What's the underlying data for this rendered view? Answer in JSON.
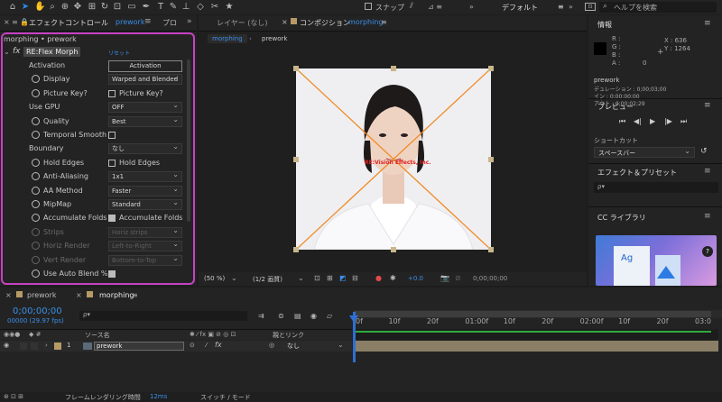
{
  "toolbar": {
    "snap_label": "スナップ",
    "workspace_label": "デフォルト",
    "search_placeholder": "ヘルプを検索"
  },
  "effects_panel": {
    "tab_label": "エフェクトコントロール",
    "tab_layer": "prework",
    "tab_other": "プロ",
    "breadcrumb": "morphing • prework",
    "effect_name": "RE:Flex Morph",
    "reset_label": "リセット",
    "rows": [
      {
        "name": "Activation",
        "type": "button",
        "value": "Activation",
        "indent": 0,
        "stopwatch": false
      },
      {
        "name": "Display",
        "type": "dropdown",
        "value": "Warped and Blended",
        "indent": 1,
        "stopwatch": true
      },
      {
        "name": "Picture Key?",
        "type": "checkbox",
        "value": "Picture Key?",
        "checked": false,
        "indent": 1,
        "stopwatch": true
      },
      {
        "name": "Use GPU",
        "type": "dropdown",
        "value": "OFF",
        "indent": 0,
        "stopwatch": false
      },
      {
        "name": "Quality",
        "type": "dropdown",
        "value": "Best",
        "indent": 1,
        "stopwatch": true
      },
      {
        "name": "Temporal Smooth",
        "type": "checkbox",
        "value": "",
        "checked": false,
        "indent": 1,
        "stopwatch": true
      },
      {
        "name": "Boundary",
        "type": "dropdown",
        "value": "なし",
        "indent": 0,
        "stopwatch": false
      },
      {
        "name": "Hold Edges",
        "type": "checkbox",
        "value": "Hold Edges",
        "checked": false,
        "indent": 1,
        "stopwatch": true
      },
      {
        "name": "Anti-Aliasing",
        "type": "dropdown",
        "value": "1x1",
        "indent": 1,
        "stopwatch": true
      },
      {
        "name": "AA Method",
        "type": "dropdown",
        "value": "Faster",
        "indent": 1,
        "stopwatch": true
      },
      {
        "name": "MipMap",
        "type": "dropdown",
        "value": "Standard",
        "indent": 1,
        "stopwatch": true
      },
      {
        "name": "Accumulate Folds",
        "type": "checkbox",
        "value": "Accumulate Folds",
        "checked": true,
        "indent": 1,
        "stopwatch": true
      },
      {
        "name": "Strips",
        "type": "dropdown",
        "value": "Horiz strips",
        "indent": 1,
        "stopwatch": true,
        "dim": true
      },
      {
        "name": "Horiz Render",
        "type": "dropdown",
        "value": "Left-to-Right",
        "indent": 1,
        "stopwatch": true,
        "dim": true
      },
      {
        "name": "Vert Render",
        "type": "dropdown",
        "value": "Bottom-to-Top",
        "indent": 1,
        "stopwatch": true,
        "dim": true
      },
      {
        "name": "Use Auto Blend %",
        "type": "checkbox",
        "value": "",
        "checked": true,
        "indent": 1,
        "stopwatch": true
      }
    ]
  },
  "viewer": {
    "layer_tab": "レイヤー (なし)",
    "comp_tab": "コンポジション",
    "comp_name": "morphing",
    "flow_items": [
      "morphing",
      "prework"
    ],
    "watermark": "RE:Vision Effects, Inc.",
    "zoom": "(50 %)",
    "resolution": "(1/2 画質)",
    "exposure": "+0.0",
    "timecode": "0;00;00;00"
  },
  "info_panel": {
    "title": "情報",
    "r": "R :",
    "g": "G :",
    "b": "B :",
    "a": "A :",
    "a_val": "0",
    "x": "X : 636",
    "y": "Y : 1264",
    "layer_name": "prework",
    "duration": "デュレーション : 0;00;03;00",
    "in": "イン : 0;00;00;00",
    "out": "アウト : 0;00;02;29"
  },
  "preview_panel": {
    "title": "プレビュー"
  },
  "shortcut": {
    "title": "ショートカット",
    "value": "スペースバー"
  },
  "effects_presets": {
    "title": "エフェクト＆プリセット",
    "search_placeholder": "ρ▾"
  },
  "cc_library": {
    "title": "CC ライブラリ",
    "ag": "Ag"
  },
  "timeline": {
    "tabs": [
      {
        "label": "prework",
        "active": false
      },
      {
        "label": "morphing",
        "active": true
      }
    ],
    "timecode": "0;00;00;00",
    "fps": "00000 (29.97 fps)",
    "col_source": "ソース名",
    "col_parent": "親とリンク",
    "ruler": [
      "0f",
      "10f",
      "20f",
      "01:00f",
      "10f",
      "20f",
      "02:00f",
      "10f",
      "20f",
      "03:0"
    ],
    "layer": {
      "index": "1",
      "name": "prework",
      "parent": "なし"
    },
    "bottom_label": "フレームレンダリング時間",
    "render_time": "12ms",
    "switch_label": "スイッチ / モード"
  }
}
